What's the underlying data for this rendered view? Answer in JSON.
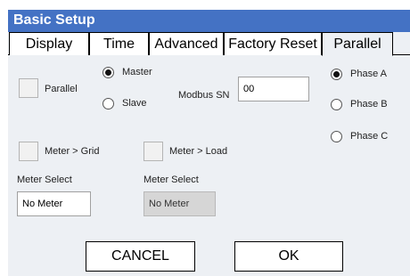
{
  "window": {
    "title": "Basic Setup"
  },
  "tabs": [
    {
      "label": "Display"
    },
    {
      "label": "Time"
    },
    {
      "label": "Advanced"
    },
    {
      "label": "Factory Reset"
    },
    {
      "label": "Parallel",
      "active": true
    }
  ],
  "parallel": {
    "parallel_label": "Parallel",
    "mode_options": [
      "Master",
      "Slave"
    ],
    "mode_selected": "Master",
    "modbus_label": "Modbus SN",
    "modbus_value": "00",
    "phase_options": [
      "Phase A",
      "Phase B",
      "Phase C"
    ],
    "phase_selected": "Phase A",
    "meter_grid_label": "Meter > Grid",
    "meter_load_label": "Meter > Load",
    "meter_select_1": {
      "label": "Meter Select",
      "value": "No Meter"
    },
    "meter_select_2": {
      "label": "Meter Select",
      "value": "No Meter",
      "disabled": true
    }
  },
  "buttons": {
    "cancel": "CANCEL",
    "ok": "OK"
  },
  "colors": {
    "titlebar": "#4472c4",
    "panel": "#edf0f4"
  }
}
